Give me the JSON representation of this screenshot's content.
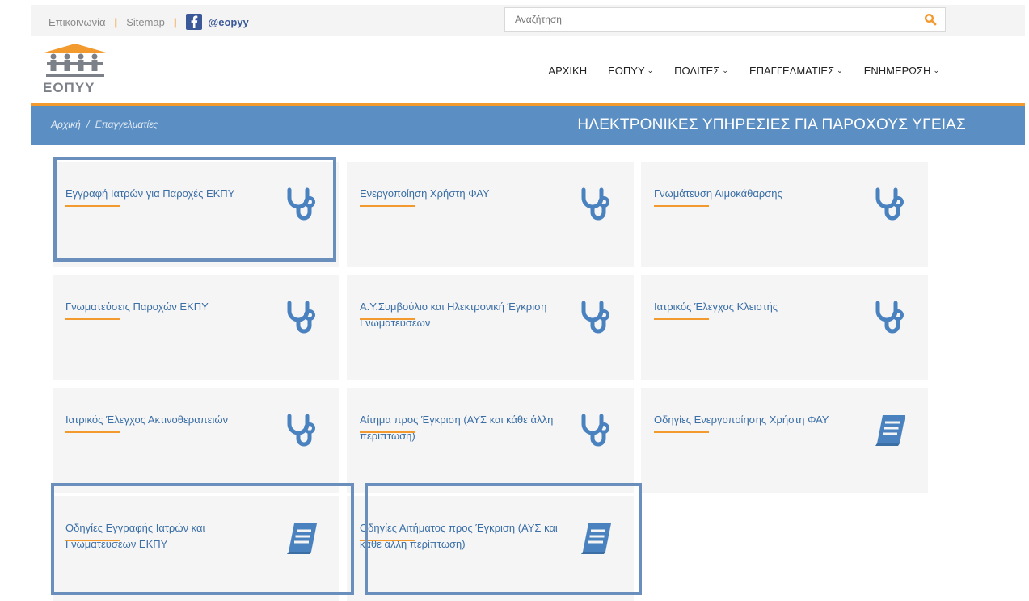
{
  "topbar": {
    "contact": "Επικοινωνία",
    "sitemap": "Sitemap",
    "fb_handle": "@eopyy",
    "search_placeholder": "Αναζήτηση"
  },
  "logo": {
    "text": "ΕΟΠΥΥ"
  },
  "nav": {
    "home": "ΑΡΧΙΚΗ",
    "eopyy": "ΕΟΠΥΥ",
    "citizens": "ΠΟΛΙΤΕΣ",
    "professionals": "ΕΠΑΓΓΕΛΜΑΤΙΕΣ",
    "news": "ΕΝΗΜΕΡΩΣΗ"
  },
  "band": {
    "crumb_home": "Αρχική",
    "crumb_sep": "/",
    "crumb_current": "Επαγγελματίες",
    "title": "ΗΛΕΚΤΡΟΝΙΚΕΣ ΥΠΗΡΕΣΙΕΣ ΓΙΑ ΠΑΡΟΧΟΥΣ ΥΓΕΙΑΣ"
  },
  "cards": [
    {
      "label": "Εγγραφή Ιατρών για Παροχές ΕΚΠΥ",
      "icon": "stethoscope-icon"
    },
    {
      "label": "Ενεργοποίηση Χρήστη ΦΑΥ",
      "icon": "stethoscope-icon"
    },
    {
      "label": "Γνωμάτευση Αιμοκάθαρσης",
      "icon": "stethoscope-icon"
    },
    {
      "label": "Γνωματεύσεις Παροχών ΕΚΠΥ",
      "icon": "stethoscope-icon"
    },
    {
      "label": "Α.Υ.Συμβούλιο και Ηλεκτρονική Έγκριση Γνωματεύσεων",
      "icon": "stethoscope-icon"
    },
    {
      "label": "Ιατρικός Έλεγχος Κλειστής",
      "icon": "stethoscope-icon"
    },
    {
      "label": "Ιατρικός Έλεγχος Ακτινοθεραπειών",
      "icon": "stethoscope-icon"
    },
    {
      "label": "Αίτημα προς Έγκριση (ΑΥΣ και κάθε άλλη περίπτωση)",
      "icon": "stethoscope-icon"
    },
    {
      "label": "Οδηγίες Ενεργοποίησης Χρήστη ΦΑΥ",
      "icon": "book-icon"
    },
    {
      "label": "Οδηγίες Εγγραφής Ιατρών και Γνωματεύσεων ΕΚΠΥ",
      "icon": "book-icon"
    },
    {
      "label": "Οδηγίες Αιτήματος προς Έγκριση (ΑΥΣ και κάθε άλλη περίπτωση)",
      "icon": "book-icon"
    }
  ],
  "colors": {
    "accent": "#f29a2e",
    "band": "#5b8fc4",
    "link": "#3a6ea5",
    "highlight": "#6b8fbd"
  }
}
